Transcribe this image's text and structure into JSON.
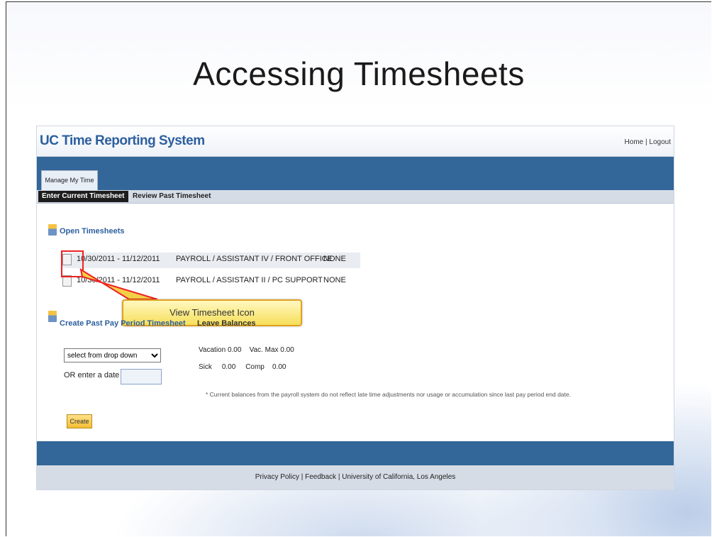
{
  "slide": {
    "title": "Accessing Timesheets"
  },
  "app": {
    "title": "UC Time Reporting System",
    "header_links": {
      "home": "Home",
      "separator": "|",
      "logout": "Logout"
    },
    "main_tab": "Manage My Time",
    "subtabs": {
      "active": "Enter Current Timesheet",
      "other": "Review Past Timesheet"
    },
    "open_timesheets": {
      "heading": "Open Timesheets",
      "rows": [
        {
          "dates": "10/30/2011 - 11/12/2011",
          "dept": "PAYROLL / ASSISTANT IV / FRONT OFFICE",
          "status": "NONE"
        },
        {
          "dates": "10/30/2011 - 11/12/2011",
          "dept": "PAYROLL / ASSISTANT II / PC SUPPORT",
          "status": "NONE"
        }
      ]
    },
    "callout": "View Timesheet Icon",
    "create_past": {
      "heading": "Create Past Pay Period Timesheet",
      "balances_heading": "Leave Balances",
      "select_value": "select from drop down",
      "or_label": "OR enter a date",
      "vacation_label": "Vacation",
      "vacation_value": "0.00",
      "vac_max_label": "Vac. Max",
      "vac_max_value": "0.00",
      "sick_label": "Sick",
      "sick_value": "0.00",
      "comp_label": "Comp",
      "comp_value": "0.00",
      "note": "* Current balances from the payroll system do not reflect late time adjustments nor usage or accumulation since last pay period end date.",
      "create_label": "Create"
    },
    "footer": {
      "privacy": "Privacy Policy",
      "sep1": "|",
      "feedback": "Feedback",
      "sep2": "|",
      "university": "University of California, Los Angeles"
    }
  },
  "colors": {
    "brand_blue": "#336699",
    "title_blue": "#2c5f9e",
    "callout_yellow": "#f6df5a",
    "highlight_red": "#ee2222"
  }
}
